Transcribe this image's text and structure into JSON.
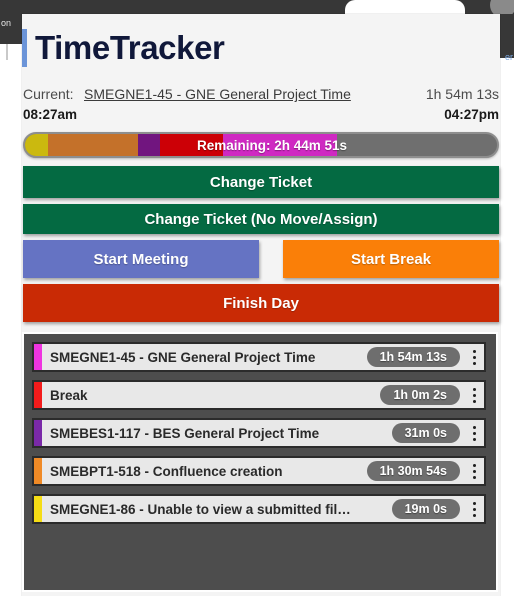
{
  "chrome": {
    "left_fragment": "on",
    "right_fragment": "er"
  },
  "header": {
    "app_title": "TimeTracker",
    "accent_color": "#6b94d8"
  },
  "current": {
    "label": "Current:",
    "ticket": "SMEGNE1-45 - GNE General Project Time",
    "elapsed": "1h 54m 13s",
    "start_time": "08:27am",
    "end_time": "04:27pm"
  },
  "progress": {
    "remaining_text": "Remaining: 2h 44m 51s",
    "track_color": "#6f6f6f",
    "segments": [
      {
        "name": "segment-yellow",
        "color": "#cbb90f",
        "left_pct": 0.0,
        "width_pct": 4.9
      },
      {
        "name": "segment-orange",
        "color": "#c4712a",
        "left_pct": 4.9,
        "width_pct": 19.0
      },
      {
        "name": "segment-purple",
        "color": "#71157f",
        "left_pct": 23.9,
        "width_pct": 4.7
      },
      {
        "name": "segment-red",
        "color": "#cc0006",
        "left_pct": 28.6,
        "width_pct": 13.3
      },
      {
        "name": "segment-magenta",
        "color": "#cf29c2",
        "left_pct": 41.9,
        "width_pct": 24.1
      }
    ]
  },
  "actions": {
    "change_ticket": "Change Ticket",
    "change_ticket_no_move": "Change Ticket (No Move/Assign)",
    "start_meeting": "Start Meeting",
    "start_break": "Start Break",
    "finish_day": "Finish Day",
    "colors": {
      "green": "#046a42",
      "blue": "#6573c3",
      "orange": "#fa7f08",
      "red": "#c92a05"
    }
  },
  "tasks": [
    {
      "color": "#ef34e0",
      "label": "SMEGNE1-45 - GNE General Project Time",
      "time": "1h 54m 13s"
    },
    {
      "color": "#f31b1b",
      "label": "Break",
      "time": "1h 0m 2s"
    },
    {
      "color": "#7a29a8",
      "label": "SMEBES1-117 - BES General Project Time",
      "time": "31m 0s"
    },
    {
      "color": "#f08a26",
      "label": "SMEBPT1-518 - Confluence creation",
      "time": "1h 30m 54s"
    },
    {
      "color": "#f5dd15",
      "label": "SMEGNE1-86 - Unable to view a submitted fil…",
      "time": "19m 0s"
    }
  ]
}
